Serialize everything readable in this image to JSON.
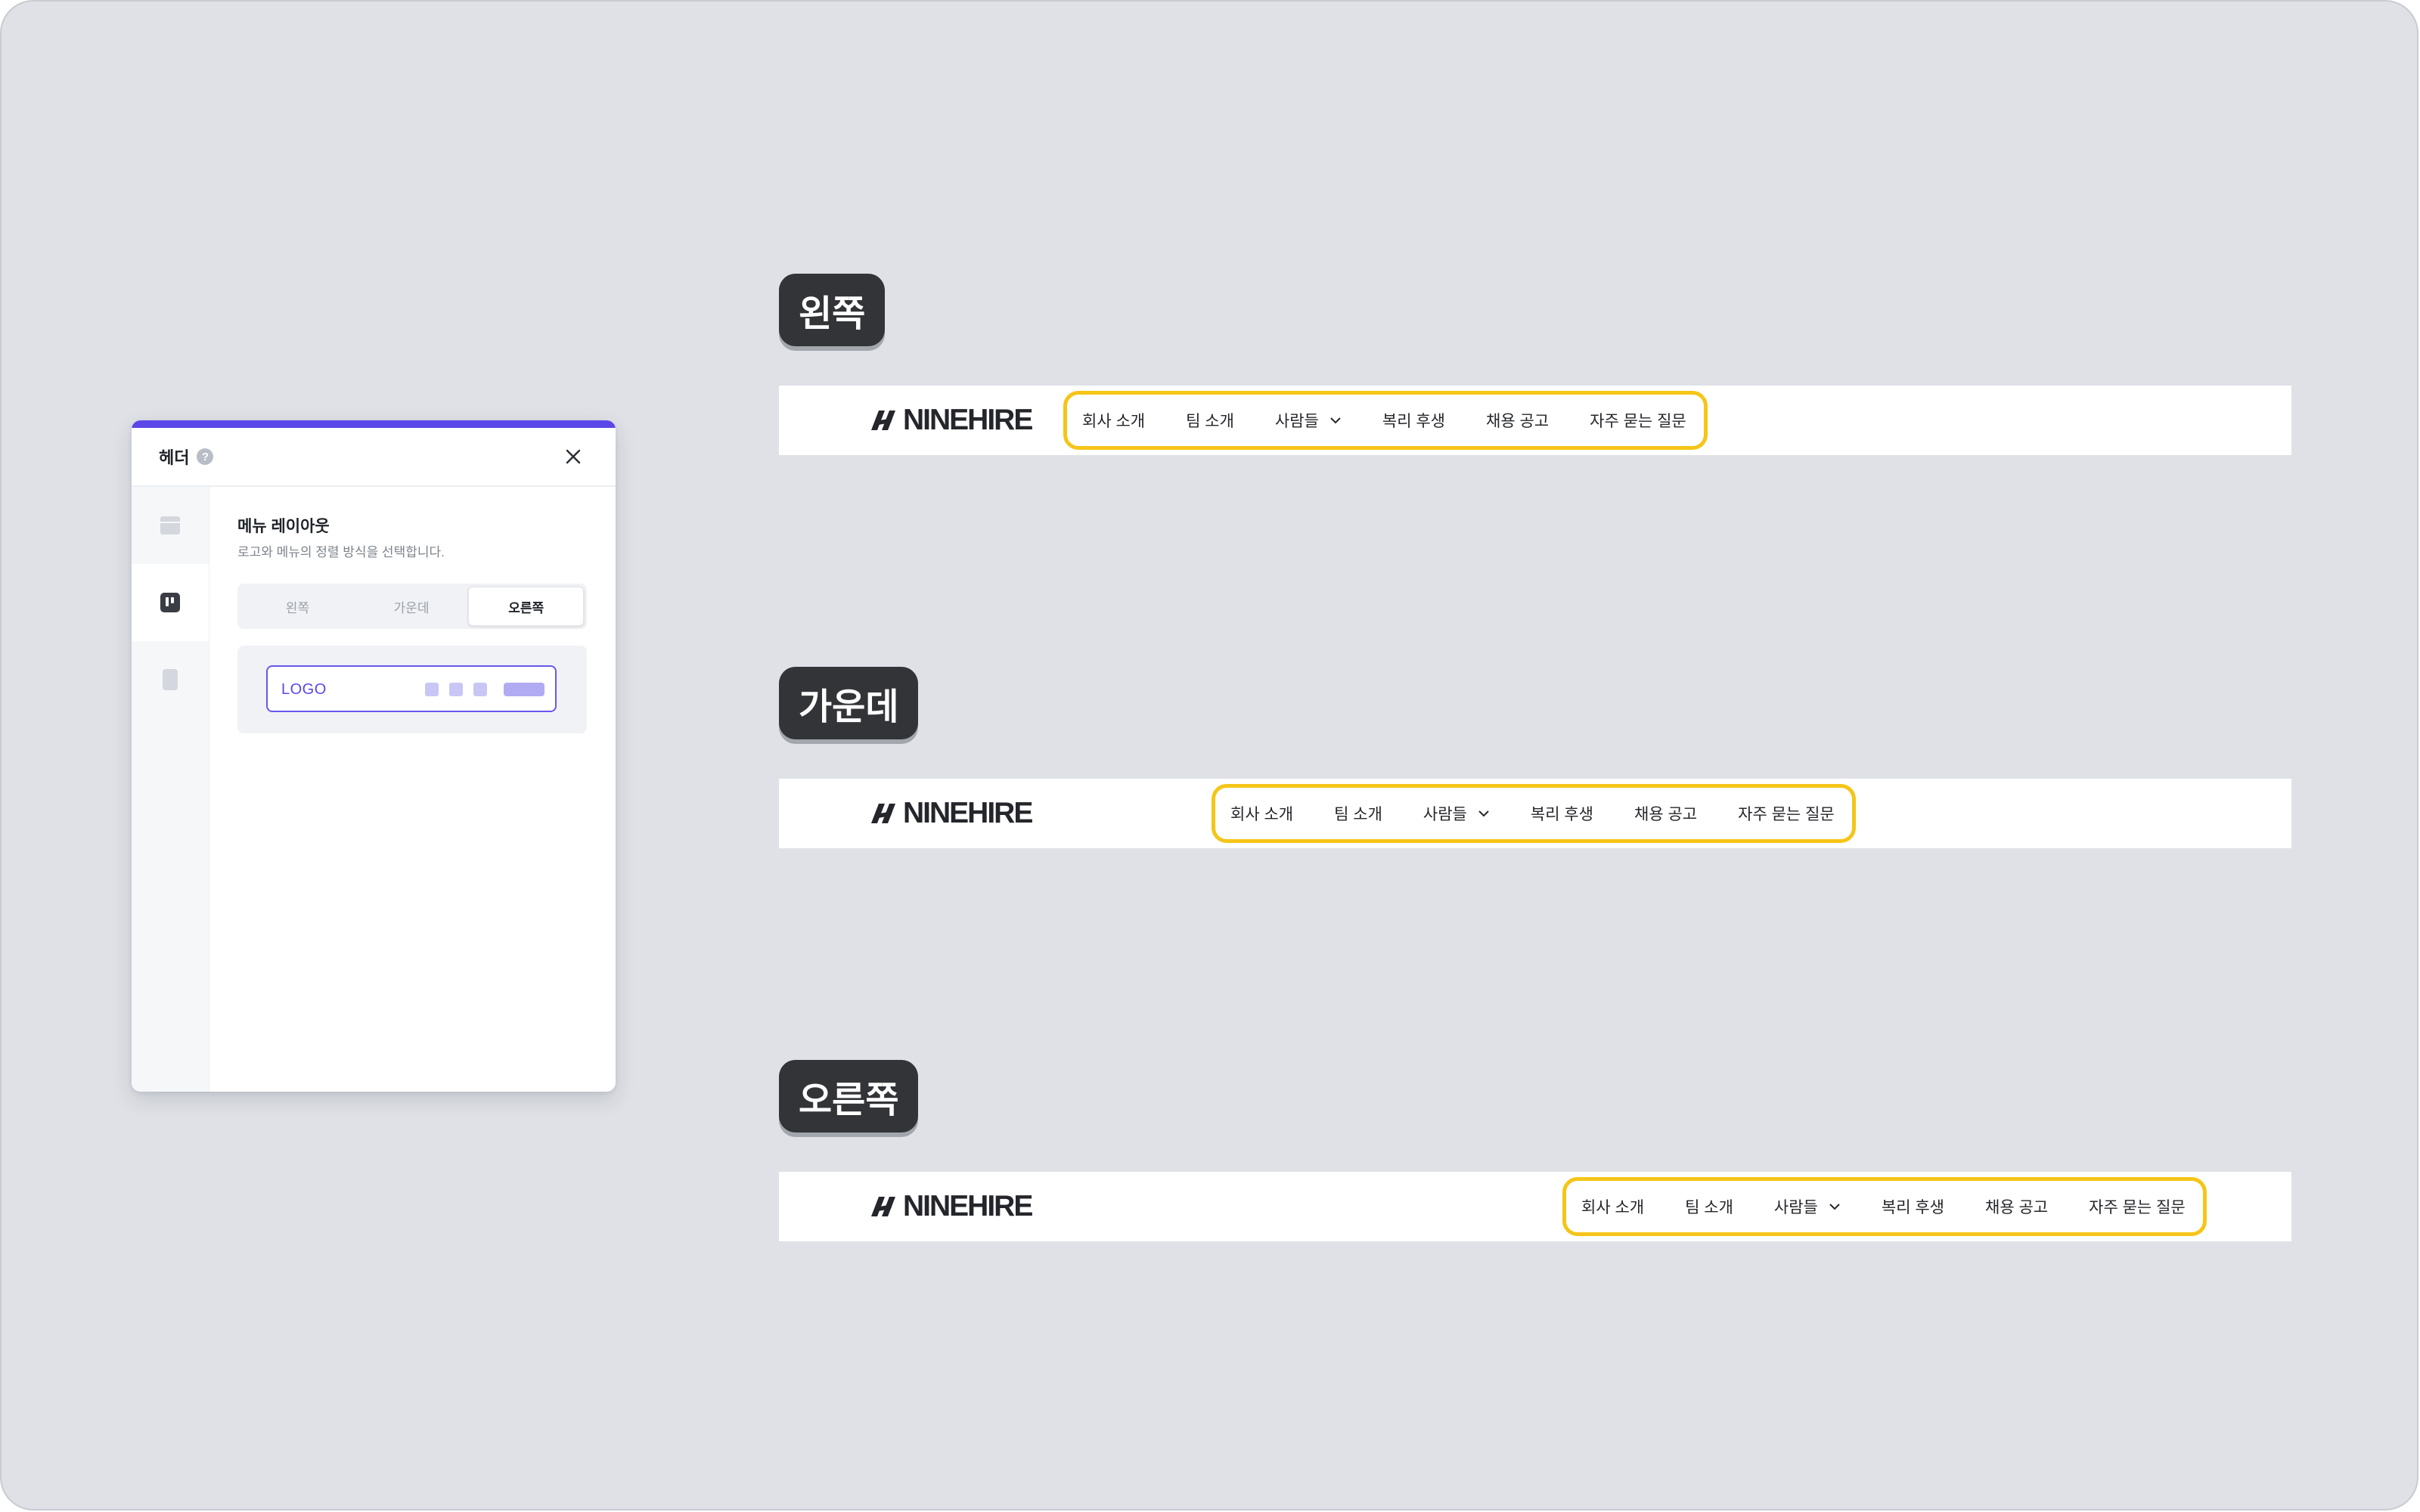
{
  "panel": {
    "title": "헤더",
    "help_icon": "question-icon",
    "close_icon": "close-icon",
    "sidebar_icons": [
      "layout-icon",
      "menu-layout-icon",
      "mobile-icon"
    ],
    "section_title": "메뉴 레이아웃",
    "section_desc": "로고와 메뉴의 정렬 방식을 선택합니다.",
    "options": [
      "왼쪽",
      "가운데",
      "오른쪽"
    ],
    "selected_option": "오른쪽",
    "preview_logo": "LOGO",
    "accent_color": "#5b46e8"
  },
  "variants": [
    {
      "label": "왼쪽"
    },
    {
      "label": "가운데"
    },
    {
      "label": "오른쪽"
    }
  ],
  "nav": {
    "brand": "NINEHIRE",
    "items": [
      "회사 소개",
      "팀 소개",
      "사람들",
      "복리 후생",
      "채용 공고",
      "자주 묻는 질문"
    ],
    "dropdown_item_index": 2,
    "highlight_color": "#f5c518"
  }
}
